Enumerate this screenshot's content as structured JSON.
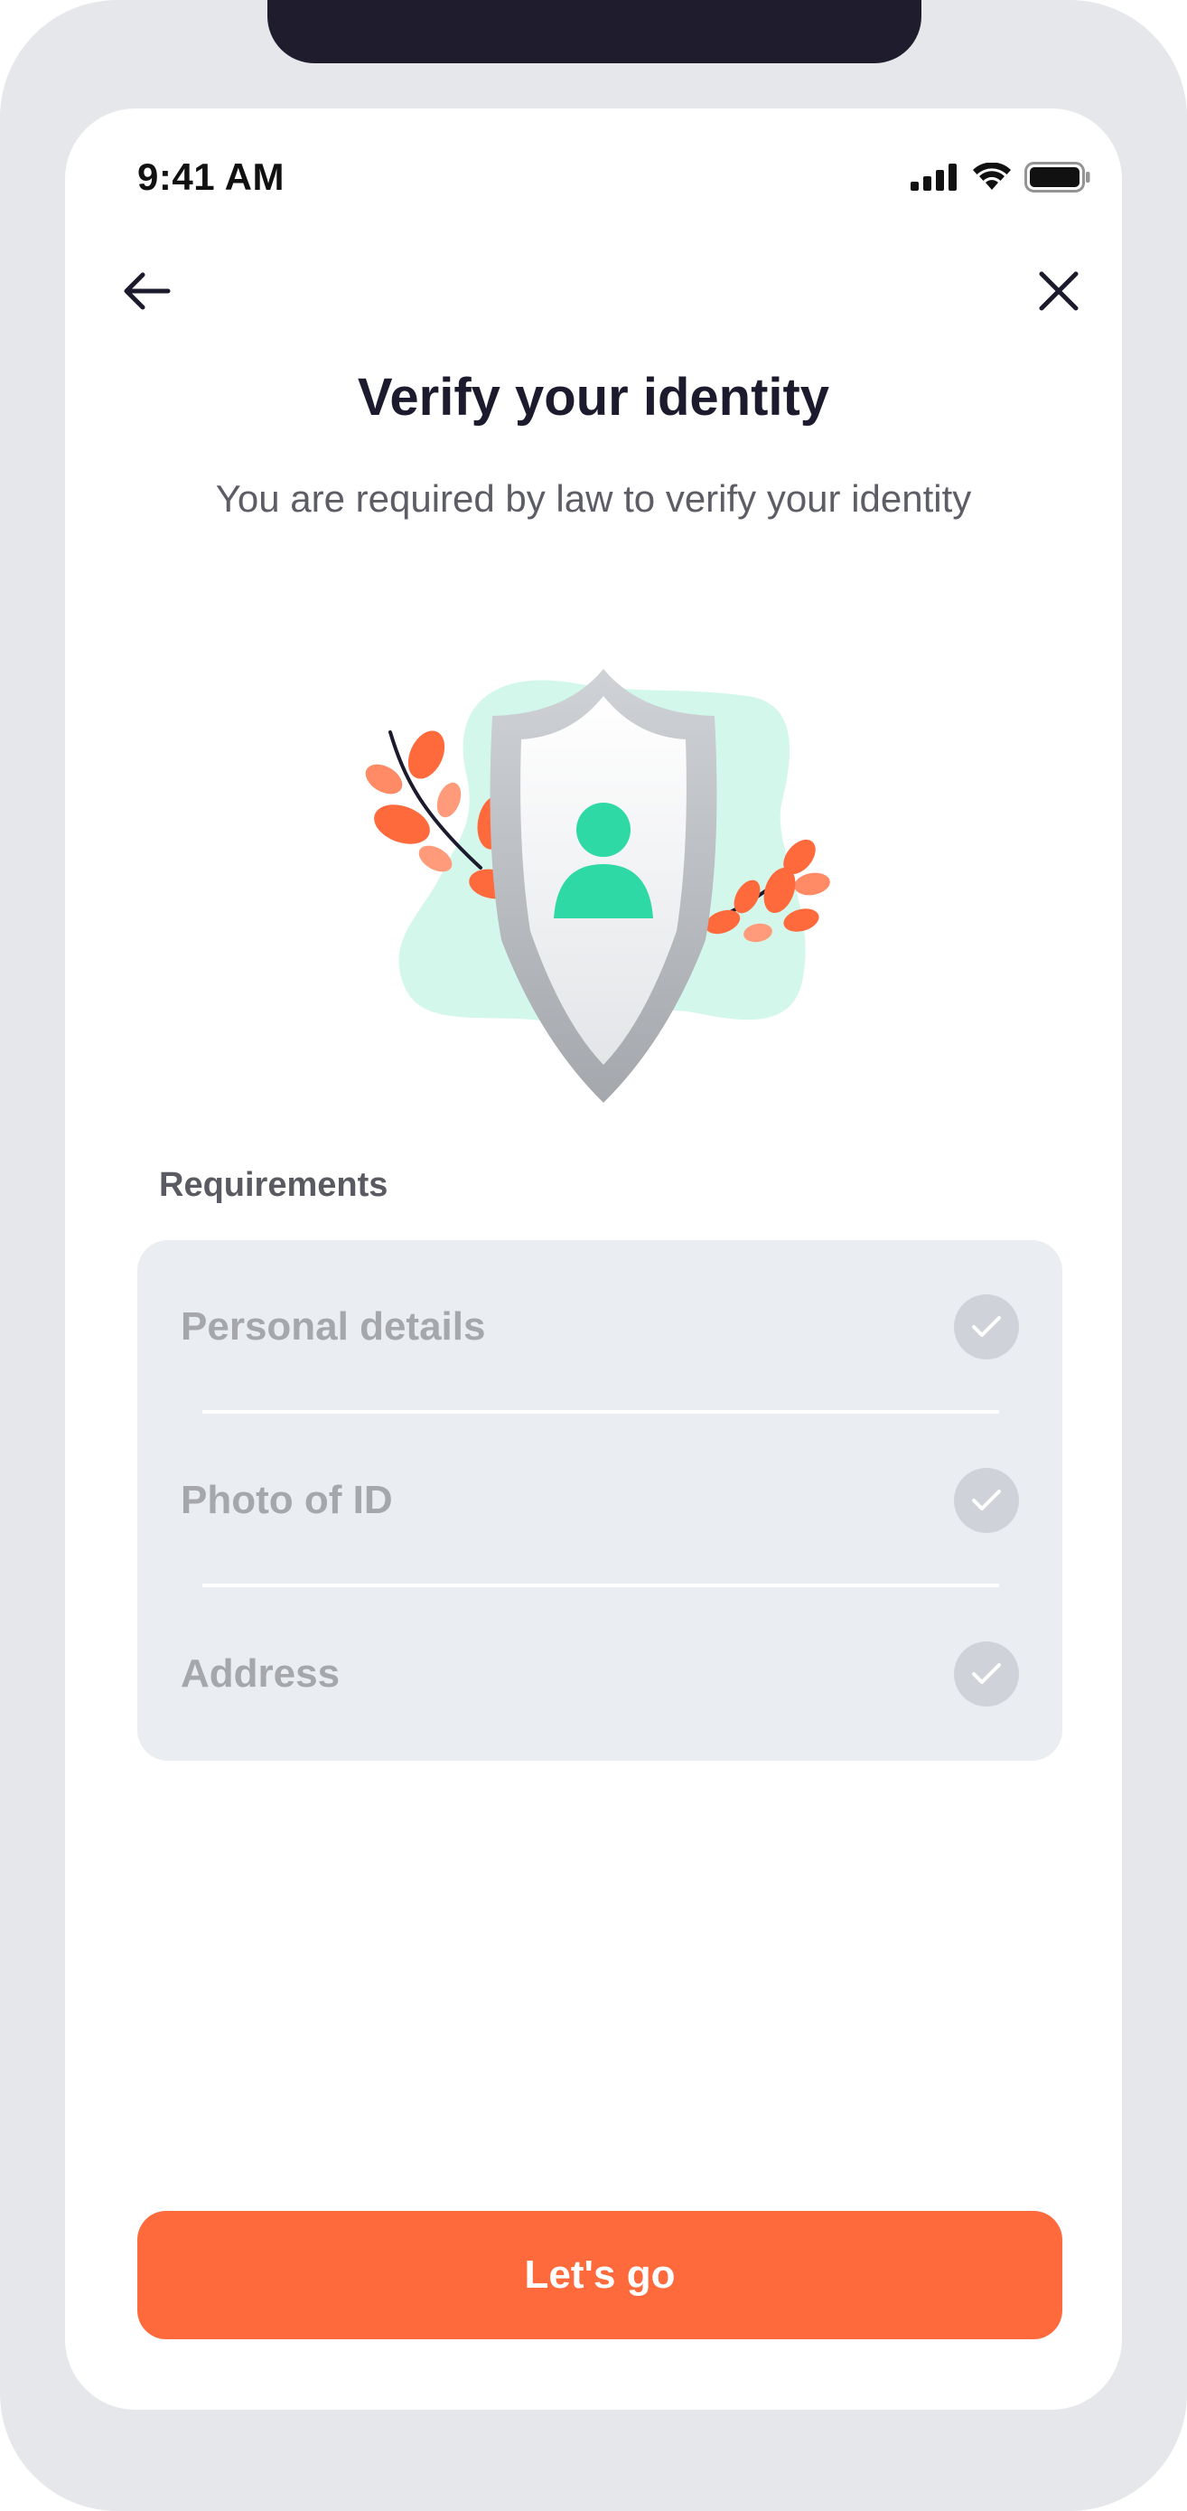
{
  "status_bar": {
    "time": "9:41 AM",
    "icons": [
      "signal-icon",
      "wifi-icon",
      "battery-icon"
    ]
  },
  "nav": {
    "back_icon": "arrow-left-icon",
    "close_icon": "close-icon"
  },
  "header": {
    "title": "Verify your identity",
    "subtitle": "You are required by law to verify your identity"
  },
  "illustration": {
    "icon": "shield-user-icon",
    "colors": {
      "blob": "#d4f7ec",
      "person": "#2ed9a5",
      "shield": "#b7babf",
      "leaves": "#ff6a3d"
    }
  },
  "requirements": {
    "label": "Requirements",
    "items": [
      {
        "label": "Personal details",
        "icon": "check-icon",
        "completed": false
      },
      {
        "label": "Photo of ID",
        "icon": "check-icon",
        "completed": false
      },
      {
        "label": "Address",
        "icon": "check-icon",
        "completed": false
      }
    ]
  },
  "cta": {
    "label": "Let's go",
    "color": "#ff6a3d"
  }
}
